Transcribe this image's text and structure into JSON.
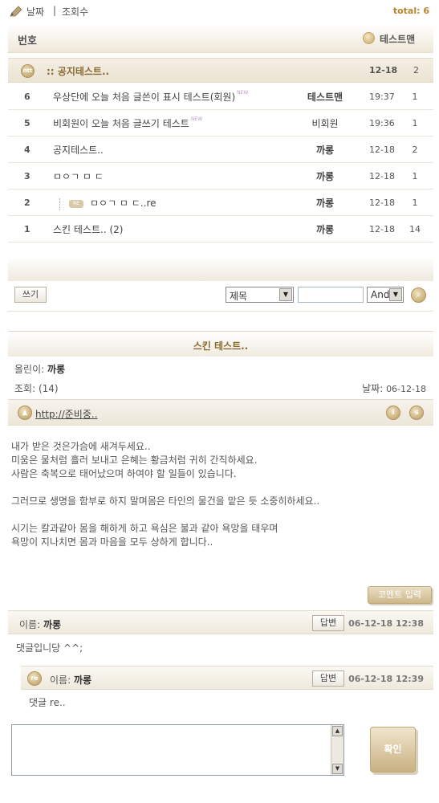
{
  "sort_bar": {
    "date_label": "날짜",
    "separator": "|",
    "views_label": "조회수",
    "total_label": "total: 6"
  },
  "list_header": {
    "number_label": "번호",
    "user_label": "테스트맨"
  },
  "notice": {
    "icon_text": "ntt",
    "title": ":: 공지테스트..",
    "date": "12-18",
    "count": "2"
  },
  "rows": [
    {
      "no": "6",
      "title": "우상단에 오늘 처음 글쓴이 표시 테스트(회원)",
      "new": "NEW",
      "author": "테스트맨",
      "date": "19:37",
      "count": "1"
    },
    {
      "no": "5",
      "title": "비회원이 오늘 처음 글쓰기 테스트",
      "new": "NEW",
      "author": "비회원",
      "date": "19:36",
      "count": "1"
    },
    {
      "no": "4",
      "title": "공지테스트..",
      "author": "까롱",
      "date": "12-18",
      "count": "2"
    },
    {
      "no": "3",
      "title": "ㅁㅇㄱ ㅁ ㄷ",
      "author": "까롱",
      "date": "12-18",
      "count": "1"
    },
    {
      "no": "2",
      "reply_tag": "RE",
      "title": "ㅁㅇㄱ ㅁ ㄷ..re",
      "author": "까롱",
      "date": "12-18",
      "count": "1"
    },
    {
      "no": "1",
      "title": "스킨 테스트.. (2)",
      "author": "까롱",
      "date": "12-18",
      "count": "14"
    }
  ],
  "toolbar": {
    "write_label": "쓰기",
    "field_select": "제목",
    "search_value": "",
    "logic_select": "And",
    "search_icon": "search-icon"
  },
  "post": {
    "title": "스킨 테스트..",
    "author_label": "올린이:",
    "author": "까롱",
    "views_label": "조회:",
    "views": "(14)",
    "date_label": "날짜:",
    "date": "06-12-18",
    "link": "http://준비중..",
    "body": [
      "내가 받은 것은가슴에 새겨두세요..",
      "미움은 물처럼 흘러 보내고 은혜는 황금처럼 귀히 간직하세요.",
      "사람은 축복으로 태어났으며 하여야 할 일들이 있습니다.",
      "그러므로 생명을 함부로 하지 말며몸은 타인의 물건을 맡은 듯 소중히하세요..",
      "시기는 칼과같아 몸을 해하게 하고 욕심은 불과 같아 욕망을 태우며",
      "욕망이 지나치면 몸과 마음을 모두 상하게 합니다.."
    ]
  },
  "comment_input_label": "코멘트 입력",
  "comments": [
    {
      "name_label": "이름:",
      "name": "까롱",
      "reply_label": "답변",
      "date": "06-12-18 12:38",
      "body": "댓글입니당 ^^;"
    },
    {
      "reply_icon": "re",
      "name_label": "이름:",
      "name": "까롱",
      "reply_label": "답변",
      "date": "06-12-18 12:39",
      "body": "댓글 re.."
    }
  ],
  "comment_form": {
    "text": "",
    "submit_label": "확인"
  },
  "colors": {
    "accent": "#8a6a33",
    "band": "#efe9dc",
    "gold": "#b6852d"
  }
}
